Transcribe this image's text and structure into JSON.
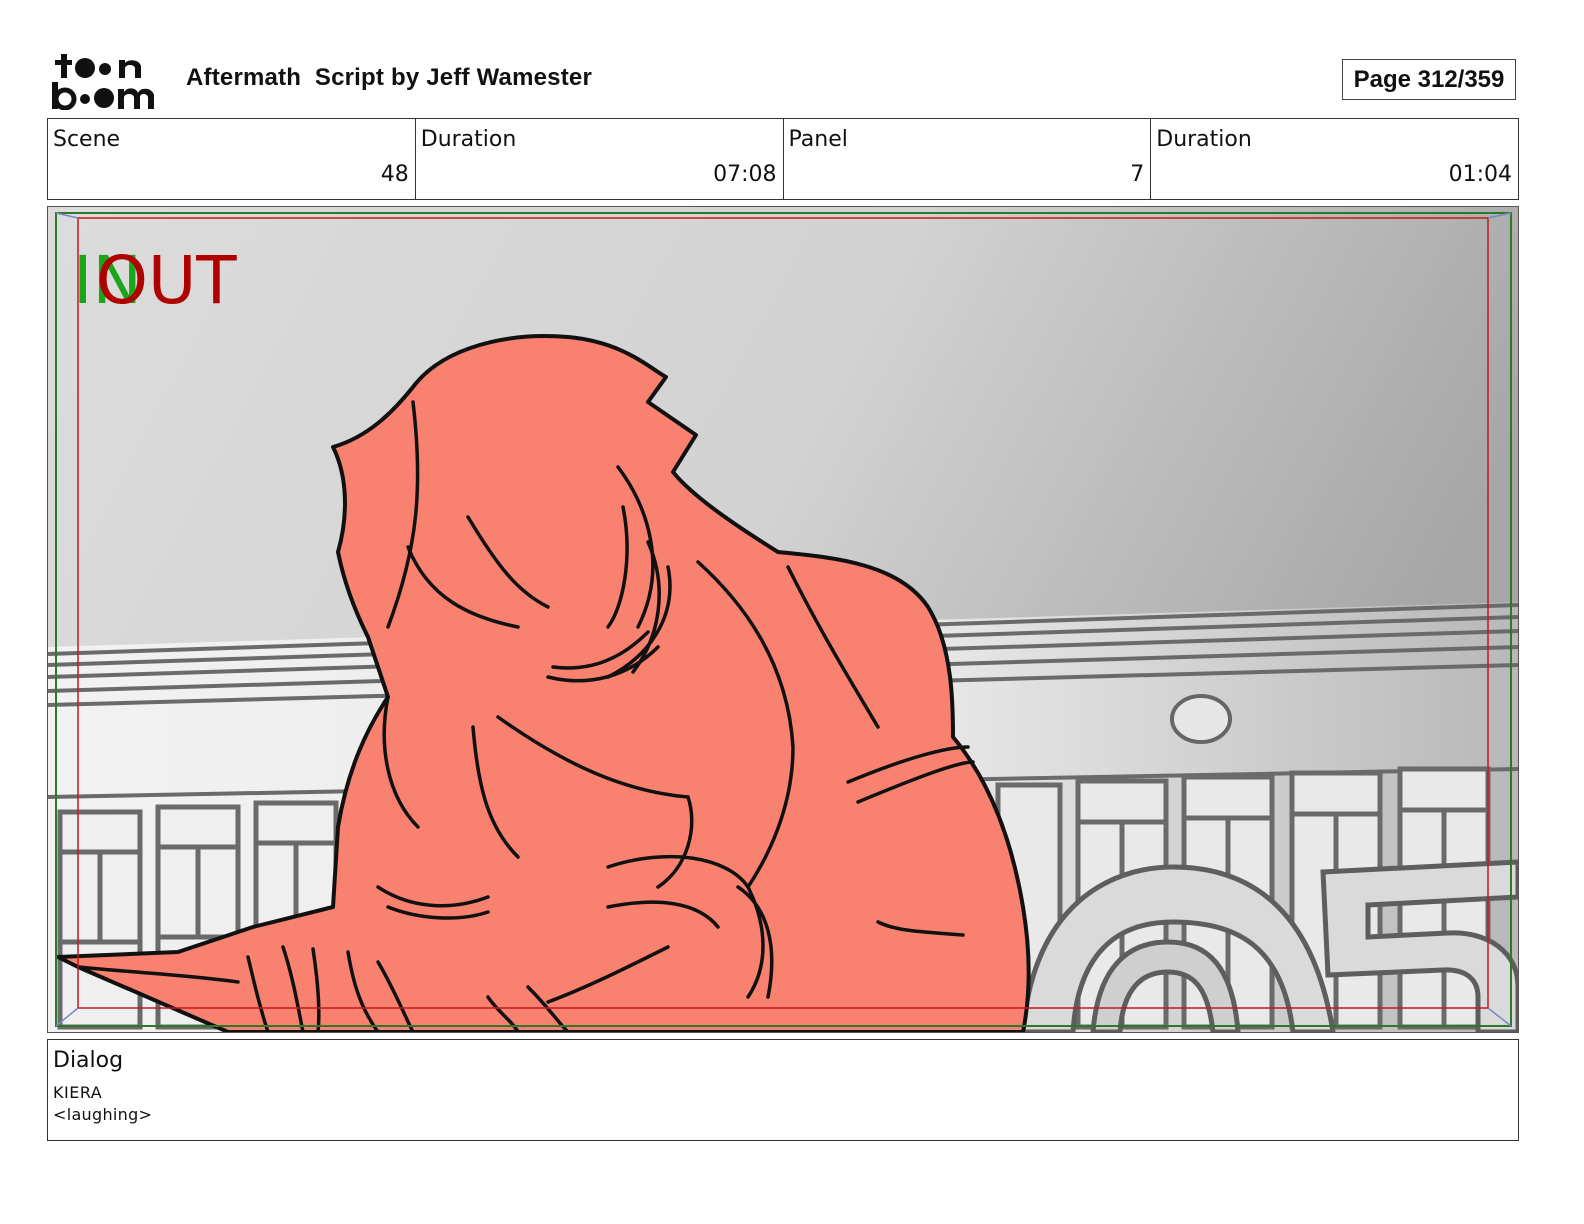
{
  "header": {
    "logo_text": "toon boom",
    "title": "Aftermath  Script by Jeff Wamester",
    "page_label": "Page 312/359"
  },
  "info": {
    "scene_label": "Scene",
    "scene_value": "48",
    "scene_duration_label": "Duration",
    "scene_duration_value": "07:08",
    "panel_label": "Panel",
    "panel_value": "7",
    "panel_duration_label": "Duration",
    "panel_duration_value": "01:04"
  },
  "panel_image": {
    "in_marker": "IN",
    "out_marker": "OUT",
    "in_color": "#1aa51a",
    "out_color": "#b00000",
    "figure_color": "#f88170"
  },
  "dialog": {
    "label": "Dialog",
    "speaker": "KIERA",
    "line": "<laughing>"
  }
}
